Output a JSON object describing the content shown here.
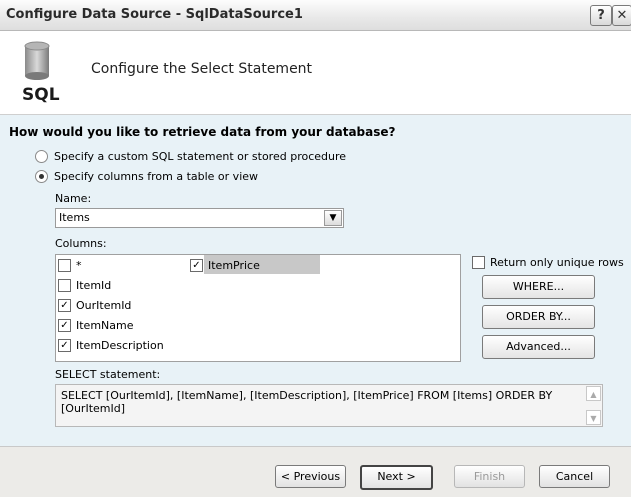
{
  "window": {
    "title": "Configure Data Source - SqlDataSource1",
    "help_label": "?",
    "close_label": "✕"
  },
  "header": {
    "icon_label": "SQL",
    "title": "Configure the Select Statement"
  },
  "question": "How would you like to retrieve data from your database?",
  "options": [
    {
      "label": "Specify a custom SQL statement or stored procedure",
      "selected": false
    },
    {
      "label": "Specify columns from a table or view",
      "selected": true
    }
  ],
  "name_label": "Name:",
  "table_select": {
    "value": "Items"
  },
  "columns_label": "Columns:",
  "columns": [
    {
      "label": "*",
      "checked": false
    },
    {
      "label": "ItemPrice",
      "checked": true
    },
    {
      "label": "ItemId",
      "checked": false
    },
    {
      "label": "OurItemId",
      "checked": true
    },
    {
      "label": "ItemName",
      "checked": true
    },
    {
      "label": "ItemDescription",
      "checked": true
    }
  ],
  "unique_rows": {
    "label": "Return only unique rows",
    "checked": false
  },
  "buttons": {
    "where": "WHERE...",
    "order_by": "ORDER BY...",
    "advanced": "Advanced..."
  },
  "select_statement_label": "SELECT statement:",
  "select_statement": "SELECT [OurItemId], [ItemName], [ItemDescription], [ItemPrice] FROM [Items] ORDER BY [OurItemId]",
  "footer": {
    "previous": "< Previous",
    "next": "Next >",
    "finish": "Finish",
    "cancel": "Cancel"
  }
}
